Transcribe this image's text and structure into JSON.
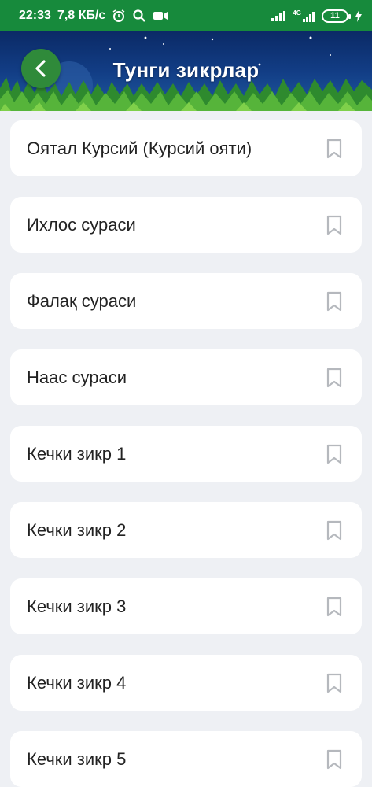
{
  "status_bar": {
    "time": "22:33",
    "net_speed": "7,8 КБ/с",
    "network_type": "4G",
    "battery": "11"
  },
  "header": {
    "title": "Тунги зикрлар"
  },
  "items": [
    {
      "label": "Оятал Курсий (Курсий ояти)"
    },
    {
      "label": "Ихлос сураси"
    },
    {
      "label": "Фалақ сураси"
    },
    {
      "label": "Наас сураси"
    },
    {
      "label": "Кечки зикр 1"
    },
    {
      "label": "Кечки зикр 2"
    },
    {
      "label": "Кечки зикр 3"
    },
    {
      "label": "Кечки зикр 4"
    },
    {
      "label": "Кечки зикр 5"
    }
  ],
  "colors": {
    "status_bar": "#178a3c",
    "back_button": "#2f8a3a",
    "background": "#eef0f4",
    "bookmark_icon": "#b5b8bd"
  }
}
